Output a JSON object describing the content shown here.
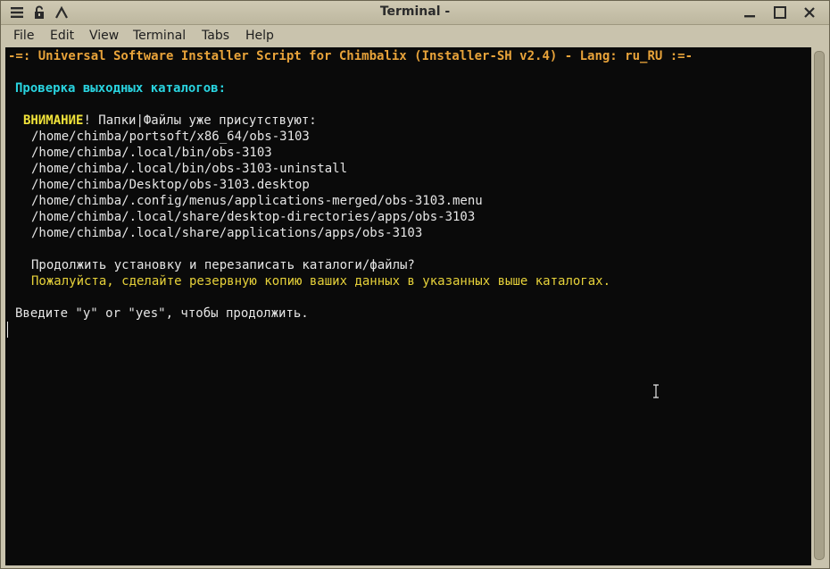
{
  "window": {
    "title": "Terminal -"
  },
  "menu": [
    "File",
    "Edit",
    "View",
    "Terminal",
    "Tabs",
    "Help"
  ],
  "icons": {
    "left": [
      "hamburger-icon",
      "lock-icon",
      "arrow-up-icon"
    ],
    "right": [
      "minimize-icon",
      "maximize-icon",
      "close-icon"
    ]
  },
  "terminal": {
    "header": "-=: Universal Software Installer Script for Chimbalix (Installer-SH v2.4) - Lang: ru_RU :=-",
    "section_title": "Проверка выходных каталогов:",
    "warning_label": "ВНИМАНИЕ",
    "warning_text": "! Папки|Файлы уже присутствуют:",
    "paths": [
      "/home/chimba/portsoft/x86_64/obs-3103",
      "/home/chimba/.local/bin/obs-3103",
      "/home/chimba/.local/bin/obs-3103-uninstall",
      "/home/chimba/Desktop/obs-3103.desktop",
      "/home/chimba/.config/menus/applications-merged/obs-3103.menu",
      "/home/chimba/.local/share/desktop-directories/apps/obs-3103",
      "/home/chimba/.local/share/applications/apps/obs-3103"
    ],
    "question": "Продолжить установку и перезаписать каталоги/файлы?",
    "backup_note": "Пожалуйста, сделайте резервную копию ваших данных в указанных выше каталогах.",
    "prompt": "Введите \"y\" or \"yes\", чтобы продолжить."
  },
  "colors": {
    "orange": "#e8a33a",
    "cyan": "#29d3df",
    "yellow": "#f2e43a",
    "background": "#0a0a0a"
  }
}
